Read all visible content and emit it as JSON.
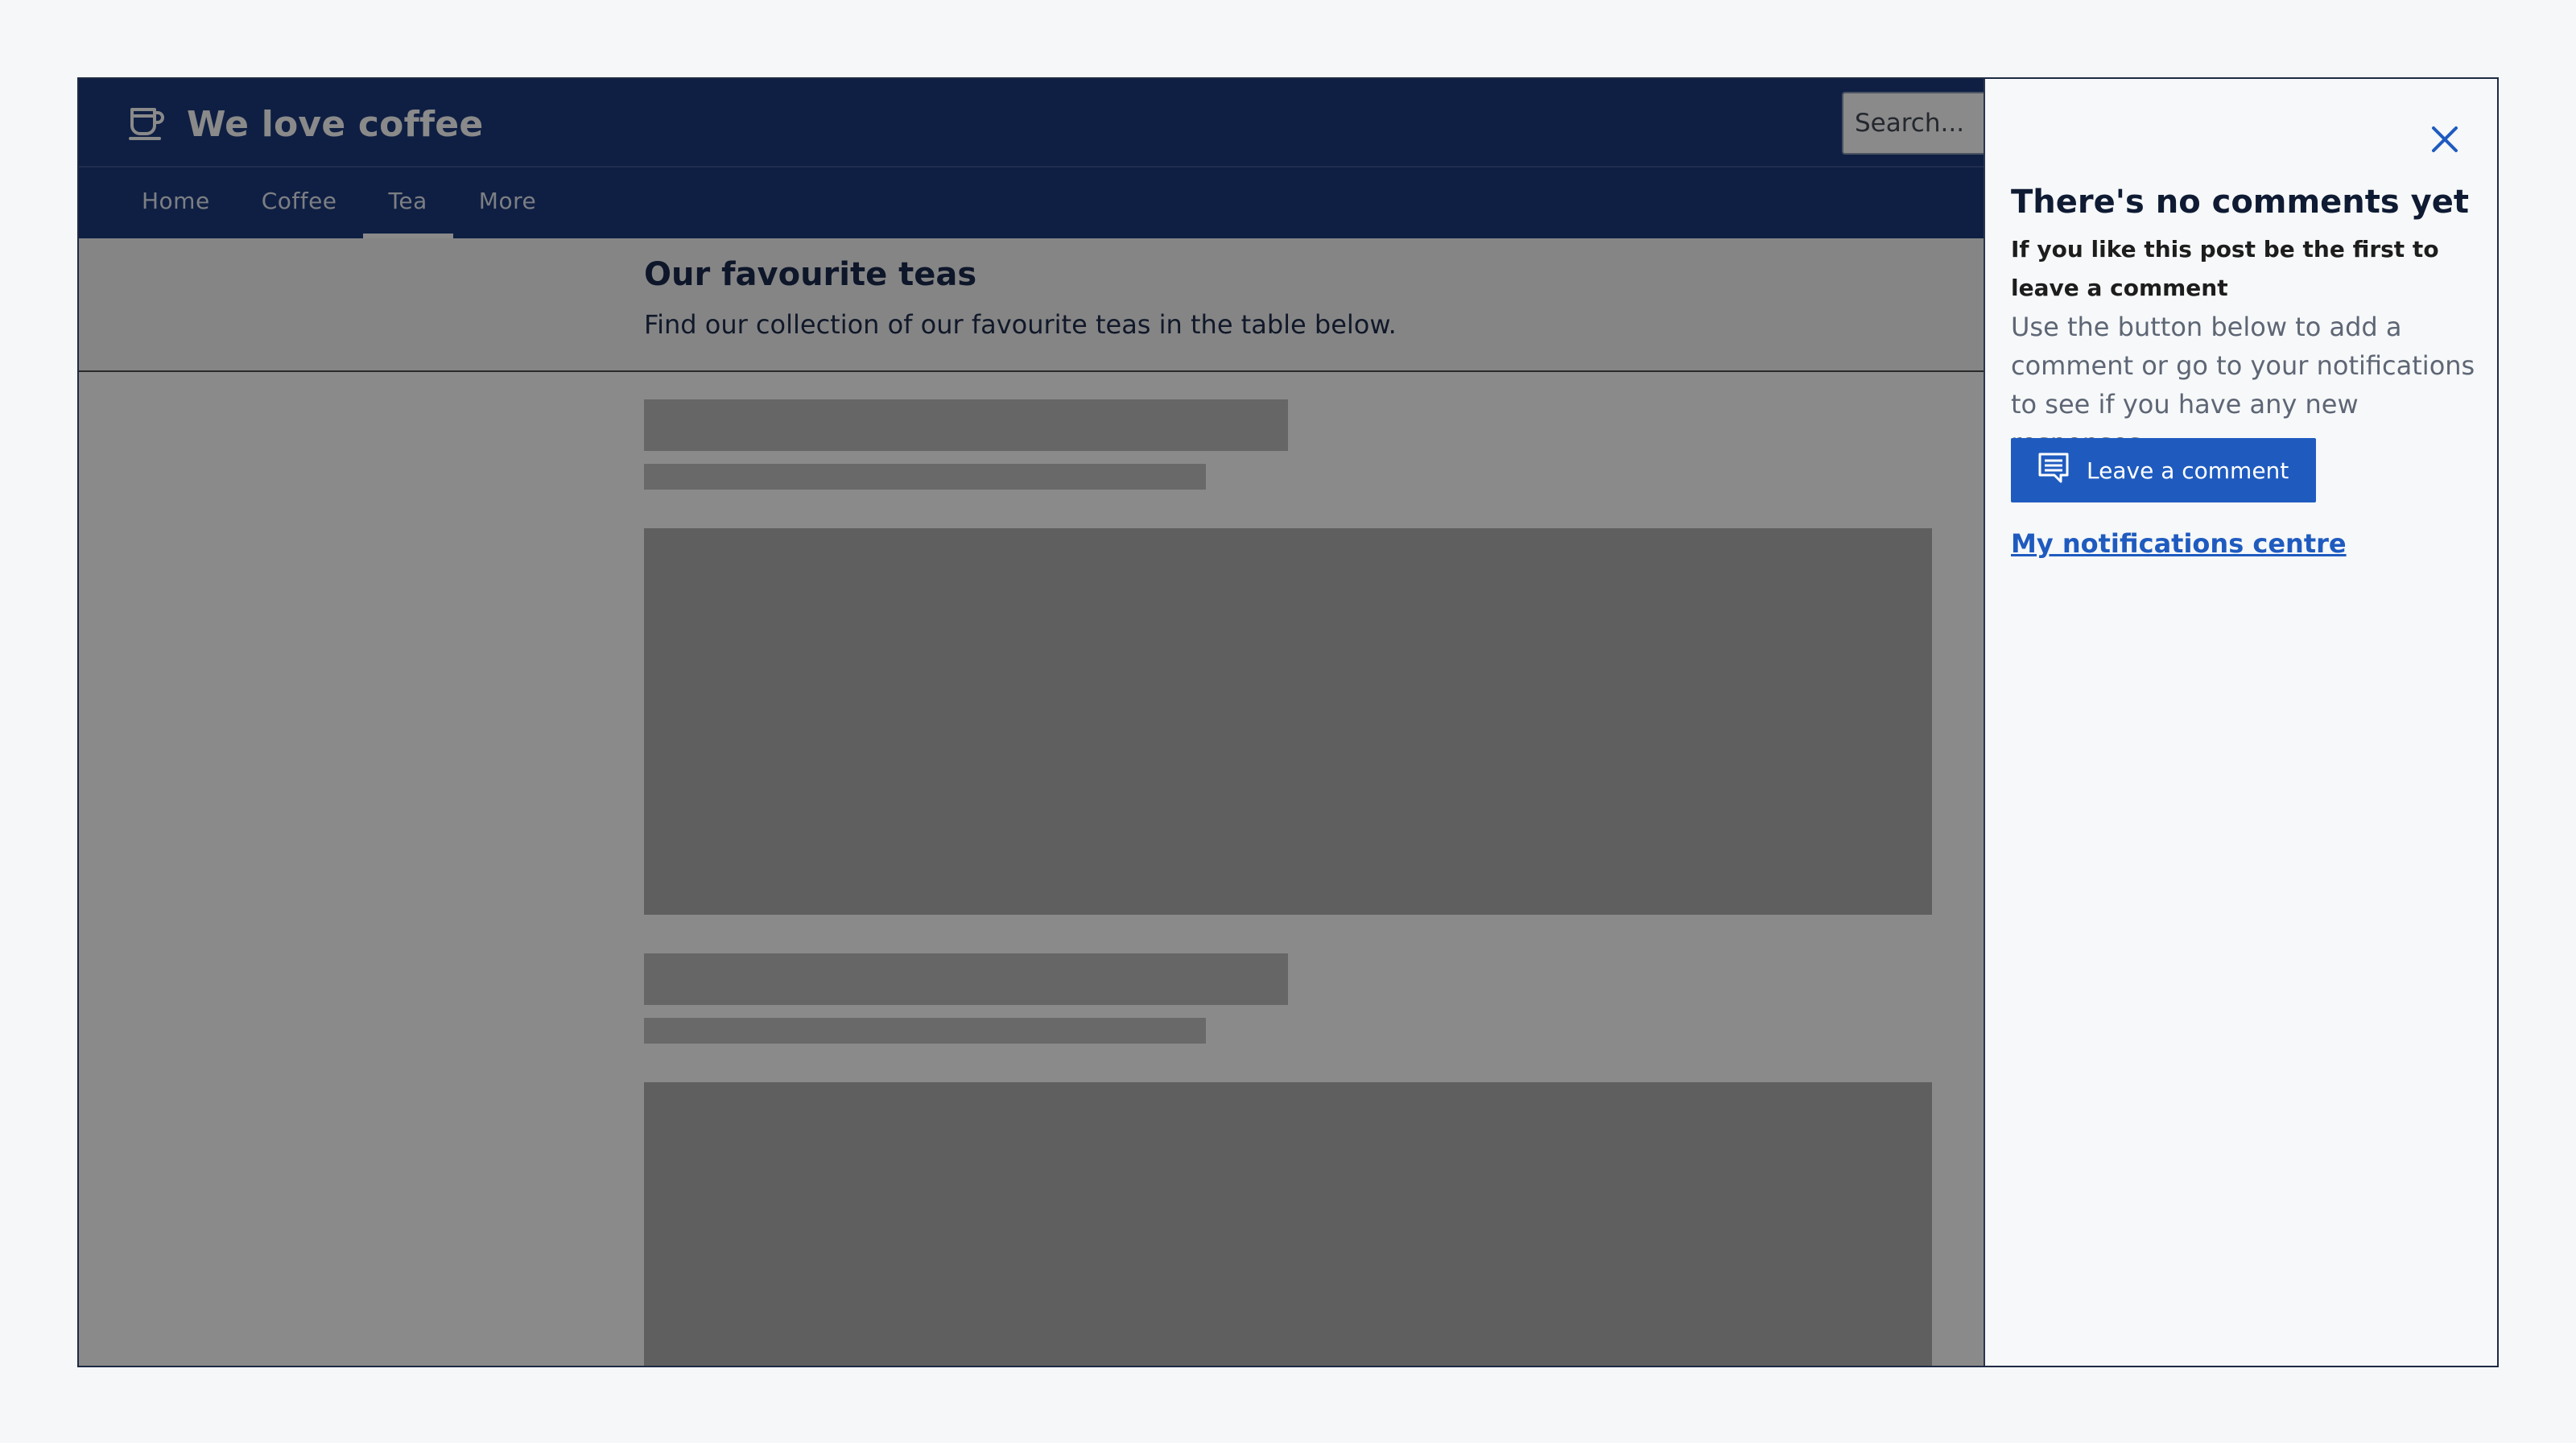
{
  "site": {
    "brand_name": "We love coffee",
    "brand_icon": "coffee-cup-icon",
    "search": {
      "placeholder": "Search..."
    },
    "nav": [
      {
        "label": "Home",
        "active": false
      },
      {
        "label": "Coffee",
        "active": false
      },
      {
        "label": "Tea",
        "active": true
      },
      {
        "label": "More",
        "active": false
      }
    ]
  },
  "main": {
    "title": "Our favourite teas",
    "subtitle": "Find our collection of our favourite teas in the table below."
  },
  "panel": {
    "close_icon": "close-icon",
    "title": "There's no comments yet",
    "lead": "If you like this post be the first to leave a comment",
    "body": "Use the button below to add a comment or go to your notifications to see if you have any new responses.",
    "comment_button": {
      "label": "Leave a comment",
      "icon": "comment-icon"
    },
    "notifications_link": "My notifications centre"
  },
  "colors": {
    "header": "#1d3a7c",
    "primary_button": "#1f5bbf",
    "link": "#1f5bbf",
    "panel_background": "#f6f8f9",
    "overlay": "rgba(0,0,0,0.46)"
  }
}
